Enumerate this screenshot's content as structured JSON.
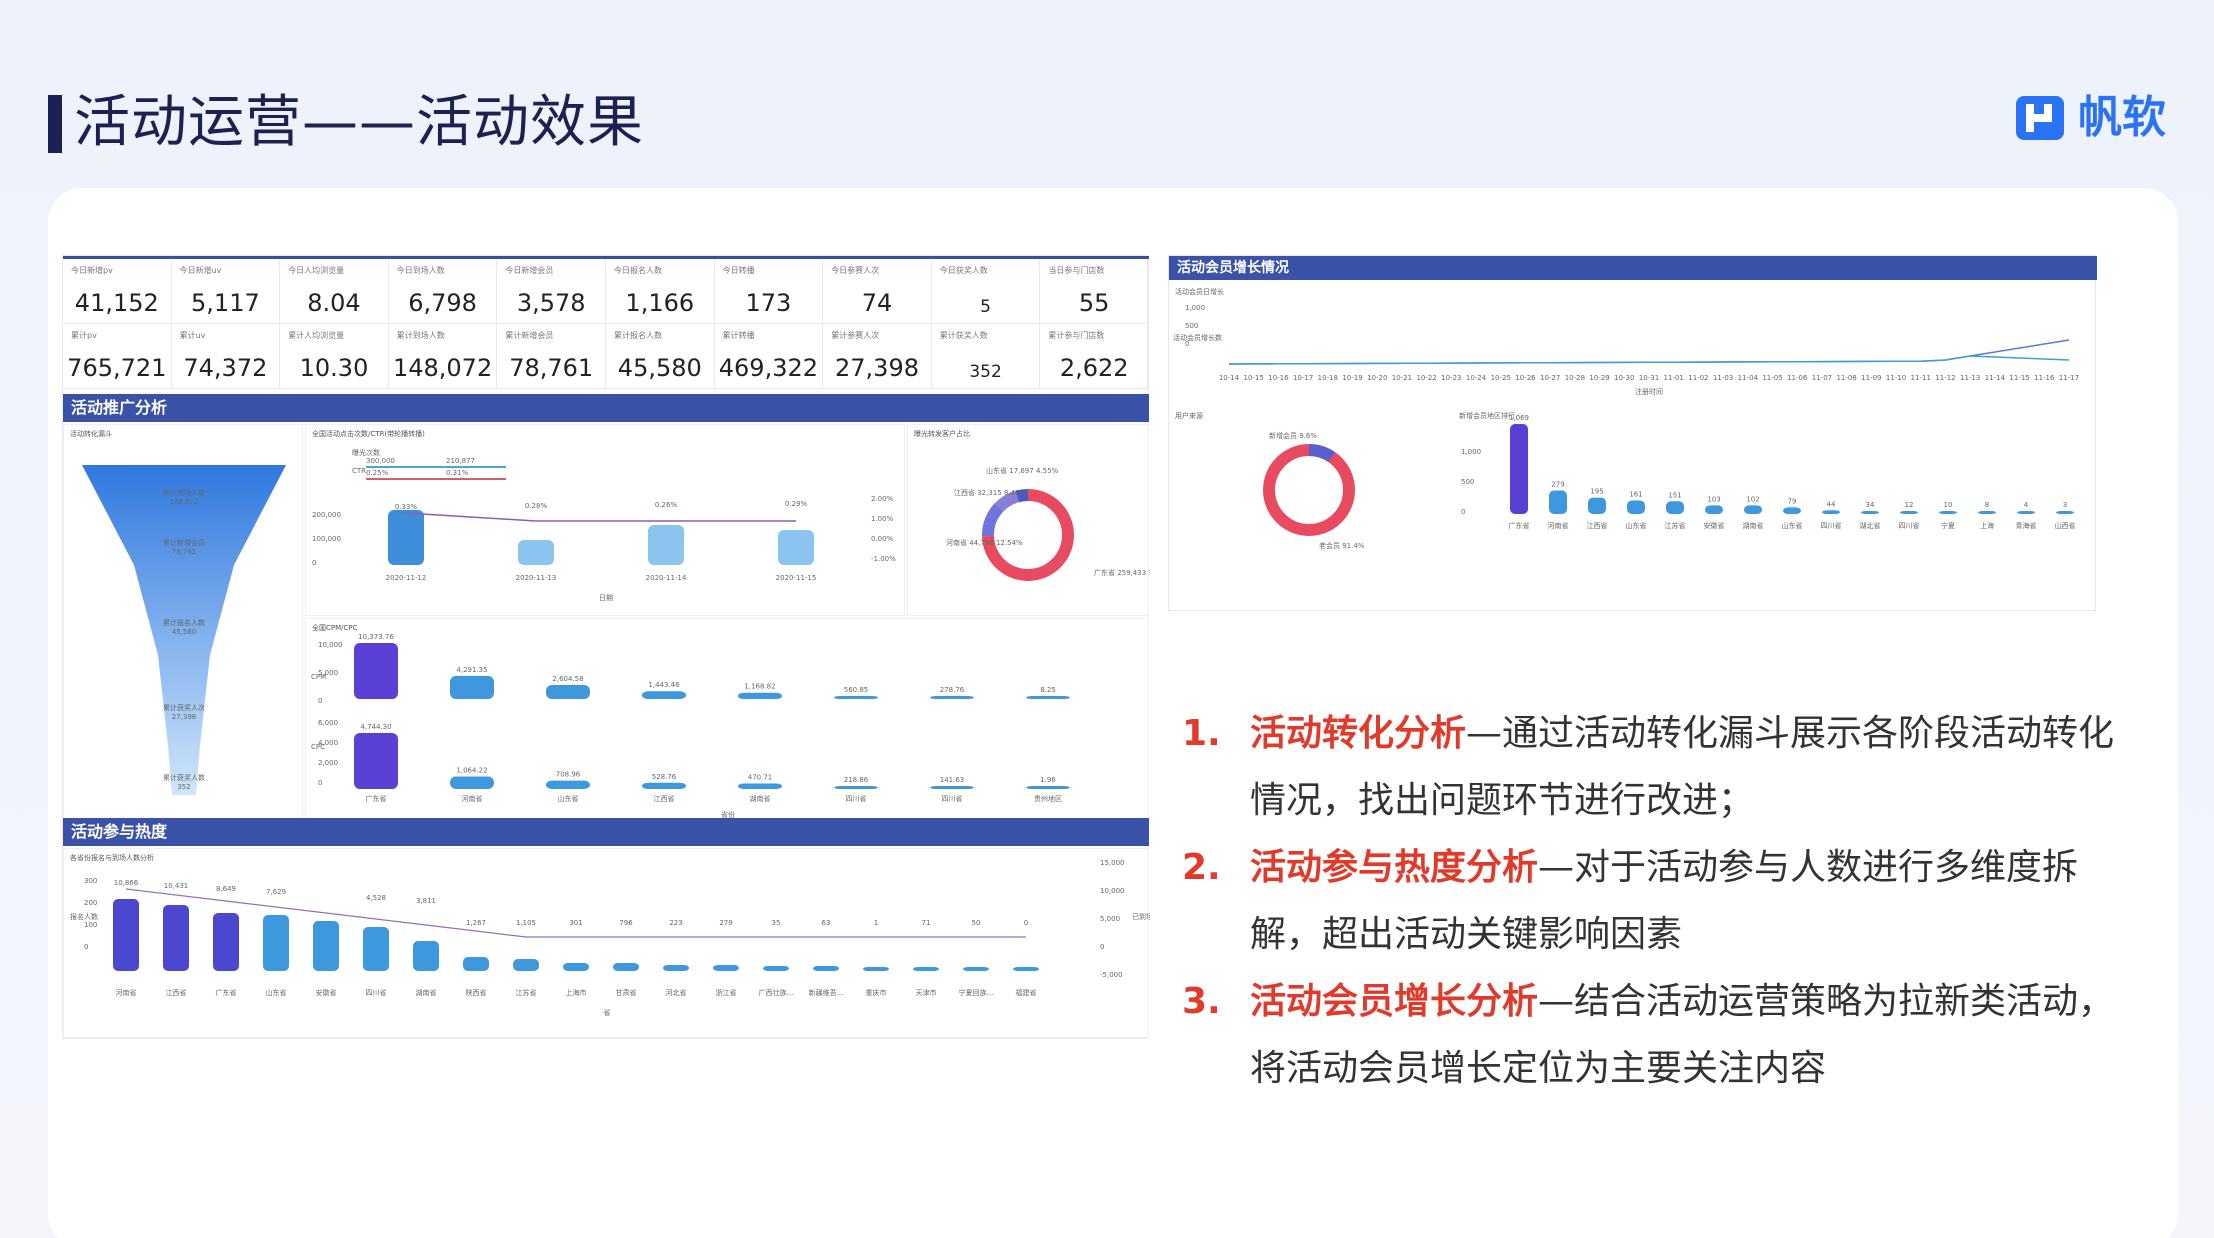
{
  "page": {
    "title": "活动运营——活动效果",
    "brand": "帆软",
    "brand_color": "#2b73f5",
    "accent_color": "#e23a2a",
    "logo_icon": "finereport-logo-icon"
  },
  "dashboard": {
    "kpis_today": [
      {
        "label": "今日新增pv",
        "value": "41,152"
      },
      {
        "label": "今日新增uv",
        "value": "5,117"
      },
      {
        "label": "今日人均浏览量",
        "value": "8.04"
      },
      {
        "label": "今日到场人数",
        "value": "6,798"
      },
      {
        "label": "今日新增会员",
        "value": "3,578"
      },
      {
        "label": "今日报名人数",
        "value": "1,166"
      },
      {
        "label": "今日转播",
        "value": "173"
      },
      {
        "label": "今日参赛人次",
        "value": "74"
      },
      {
        "label": "今日获奖人数",
        "value": "5"
      },
      {
        "label": "当日参与门店数",
        "value": "55"
      }
    ],
    "kpis_total": [
      {
        "label": "累计pv",
        "value": "765,721"
      },
      {
        "label": "累计uv",
        "value": "74,372"
      },
      {
        "label": "累计人均浏览量",
        "value": "10.30"
      },
      {
        "label": "累计到场人数",
        "value": "148,072"
      },
      {
        "label": "累计新增会员",
        "value": "78,761"
      },
      {
        "label": "累计报名人数",
        "value": "45,580"
      },
      {
        "label": "累计转播",
        "value": "469,322"
      },
      {
        "label": "累计参赛人次",
        "value": "27,398"
      },
      {
        "label": "累计获奖人数",
        "value": "352"
      },
      {
        "label": "累计参与门店数",
        "value": "2,622"
      }
    ],
    "section_promo": "活动推广分析",
    "section_heat": "活动参与热度",
    "funnel": {
      "title": "活动转化漏斗",
      "stages": [
        {
          "label": "累计到场人数",
          "value": "148,072"
        },
        {
          "label": "累计新增会员",
          "value": "78,761"
        },
        {
          "label": "累计报名人数",
          "value": "45,580"
        },
        {
          "label": "累计获奖人次",
          "value": "27,398"
        },
        {
          "label": "累计获奖人数",
          "value": "352"
        }
      ]
    },
    "ctr_chart": {
      "title": "全国活动点击次数/CTR(带轮播转播)",
      "legend": [
        "曝光次数",
        "CTR"
      ],
      "legend_vals": [
        "300,000",
        "210,877",
        "0.25%",
        "0.31%"
      ],
      "dates": [
        "2020-11-12",
        "2020-11-13",
        "2020-11-14",
        "2020-11-15"
      ],
      "ctr_labels": [
        "0.33%",
        "0.28%",
        "0.26%",
        "0.29%"
      ],
      "xlabel": "日期",
      "yticks": [
        "200,000",
        "100,000",
        "0"
      ],
      "rticks": [
        "2.00%",
        "1.00%",
        "0.00%",
        "-1.00%"
      ]
    },
    "donut_top": {
      "title": "曝光转发客户占比",
      "labels": [
        "山东省 17,697 4.55%",
        "江西省 32,315 8.48%",
        "河南省 44,798 12.54%",
        "广东省 259,433 74.43%"
      ]
    },
    "cpm_chart": {
      "title": "全国CPM/CPC",
      "provinces": [
        "广东省",
        "河南省",
        "山东省",
        "江西省",
        "湖南省",
        "四川省",
        "四川省",
        "贵州地区"
      ],
      "cpm_labels": [
        "10,373.76",
        "4,291.35",
        "2,604.58",
        "1,443.46",
        "1,168.82",
        "560.85",
        "278.76",
        "8.25"
      ],
      "cpc_labels": [
        "4,744.30",
        "1,064.22",
        "708.96",
        "528.76",
        "470.71",
        "218.86",
        "141.63",
        "1.96"
      ],
      "ylab_top": "CPM",
      "ylab_bot": "CPC",
      "yticks_top": [
        "10,000",
        "5,000",
        "0"
      ],
      "yticks_bot": [
        "6,000",
        "4,000",
        "2,000",
        "0"
      ],
      "xlabel": "省份"
    },
    "heat_chart": {
      "title": "各省份报名与到场人数分析",
      "provinces": [
        "河南省",
        "江西省",
        "广东省",
        "山东省",
        "安徽省",
        "四川省",
        "湖南省",
        "陕西省",
        "江苏省",
        "上海市",
        "甘肃省",
        "河北省",
        "浙江省",
        "广西壮族...",
        "新疆维吾...",
        "重庆市",
        "天津市",
        "宁夏回族...",
        "福建省"
      ],
      "top_labels": [
        "10,866",
        "10,431",
        "8,649",
        "7,629",
        "",
        "4,528",
        "3,811",
        "1,267",
        "1,105",
        "301",
        "796",
        "223",
        "279",
        "35",
        "63",
        "1",
        "71",
        "50",
        "0"
      ],
      "ylab": "报名人数",
      "rlab": "已到场数",
      "yticks": [
        "300",
        "200",
        "100",
        "0"
      ],
      "rticks": [
        "15,000",
        "10,000",
        "5,000",
        "0",
        "-5,000"
      ],
      "xlabel": "省"
    }
  },
  "growth": {
    "title": "活动会员增长情况",
    "sub": "活动会员日增长",
    "ylab": "活动会员增长数",
    "xlabel": "注册时间",
    "yticks": [
      "1,000",
      "500",
      "0"
    ],
    "dates": [
      "10-14",
      "10-15",
      "10-16",
      "10-17",
      "10-18",
      "10-19",
      "10-20",
      "10-21",
      "10-22",
      "10-23",
      "10-24",
      "10-25",
      "10-26",
      "10-27",
      "10-28",
      "10-29",
      "10-30",
      "10-31",
      "11-01",
      "11-02",
      "11-03",
      "11-04",
      "11-05",
      "11-06",
      "11-07",
      "11-08",
      "11-09",
      "11-10",
      "11-11",
      "11-12",
      "11-13",
      "11-14",
      "11-15",
      "11-16",
      "11-17"
    ],
    "donut_title": "用户来源",
    "donut_labels": [
      "新增会员 9.6%",
      "老会员 91.4%"
    ],
    "bar_title": "新增会员地区排行",
    "bar_provinces": [
      "广东省",
      "河南省",
      "江西省",
      "山东省",
      "江苏省",
      "安徽省",
      "湖南省",
      "山东省",
      "四川省",
      "湖北省",
      "四川省",
      "宁夏",
      "上海",
      "青海省",
      "山西省"
    ],
    "bar_labels": [
      "1,069",
      "279",
      "195",
      "161",
      "151",
      "103",
      "102",
      "79",
      "44",
      "34",
      "12",
      "10",
      "8",
      "4",
      "3"
    ]
  },
  "notes": [
    {
      "num": "1.",
      "highlight": "活动转化分析",
      "rest": "—通过活动转化漏斗展示各阶段活动转化情况，找出问题环节进行改进；"
    },
    {
      "num": "2.",
      "highlight": "活动参与热度分析",
      "rest": "—对于活动参与人数进行多维度拆解，超出活动关键影响因素"
    },
    {
      "num": "3.",
      "highlight": "活动会员增长分析",
      "rest": "—结合活动运营策略为拉新类活动，将活动会员增长定位为主要关注内容"
    }
  ]
}
